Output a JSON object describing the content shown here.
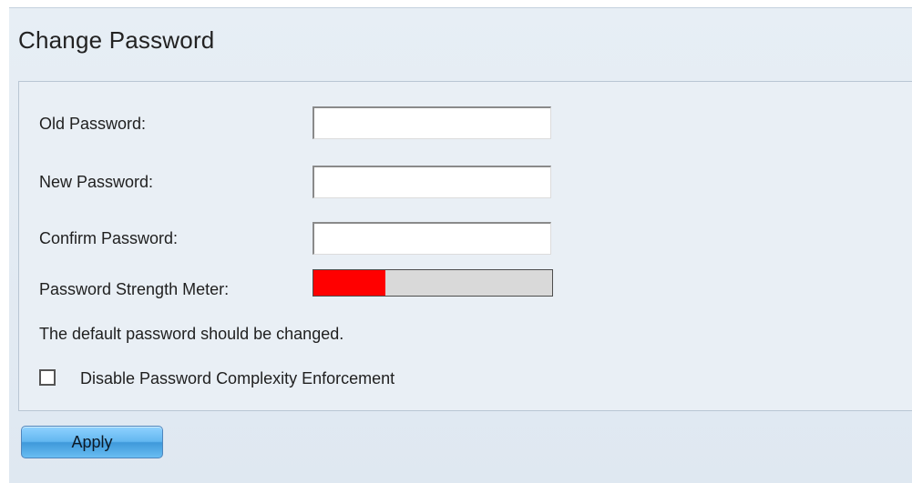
{
  "page": {
    "title": "Change Password"
  },
  "form": {
    "old_password": {
      "label": "Old Password:",
      "value": ""
    },
    "new_password": {
      "label": "New Password:",
      "value": ""
    },
    "confirm_password": {
      "label": "Confirm Password:",
      "value": ""
    },
    "strength_meter": {
      "label": "Password Strength Meter:",
      "level_percent": 30,
      "fill_color": "#ff0000",
      "track_color": "#d9d9d9"
    },
    "notice": "The default password should be changed.",
    "disable_complexity": {
      "label": "Disable Password Complexity Enforcement",
      "checked": false
    }
  },
  "actions": {
    "apply_label": "Apply"
  }
}
